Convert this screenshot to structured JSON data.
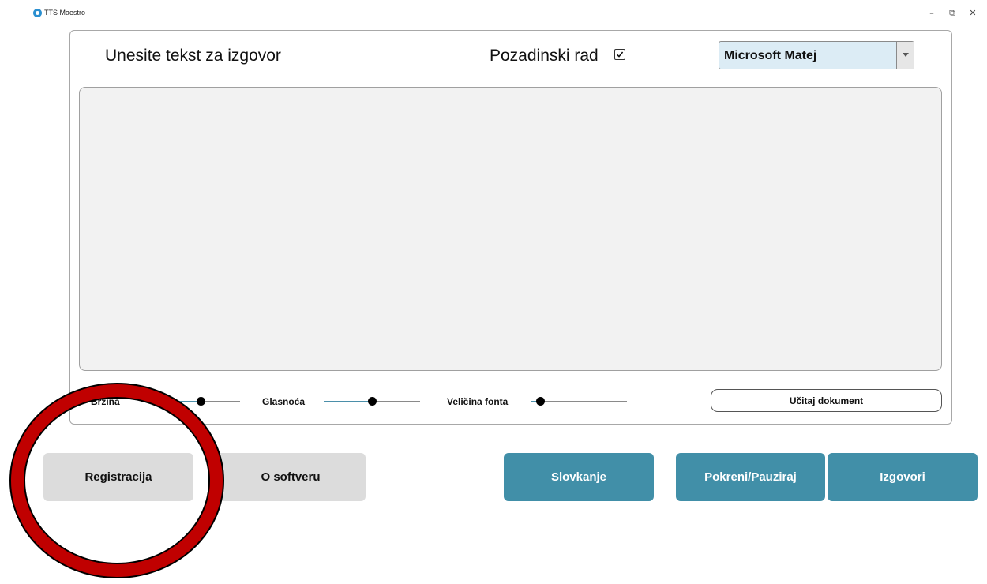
{
  "window": {
    "title": "TTS Maestro",
    "minimize": "–",
    "restore": "⧉",
    "close": "✕"
  },
  "header": {
    "prompt_label": "Unesite tekst za izgovor",
    "background_label": "Pozadinski rad",
    "background_checked": true,
    "voice_selected": "Microsoft Matej"
  },
  "editor": {
    "text": ""
  },
  "sliders": [
    {
      "label": "Brzina",
      "value": 0.6
    },
    {
      "label": "Glasnoća",
      "value": 0.5
    },
    {
      "label": "Veličina fonta",
      "value": 0.1
    }
  ],
  "load_document_label": "Učitaj dokument",
  "buttons": {
    "registration": "Registracija",
    "about": "O softveru",
    "spelling": "Slovkanje",
    "start_pause": "Pokreni/Pauziraj",
    "speak": "Izgovori"
  },
  "colors": {
    "accent": "#418fa8",
    "secondary_button": "#dcdcdc",
    "annotation_ring": "#c00000"
  }
}
